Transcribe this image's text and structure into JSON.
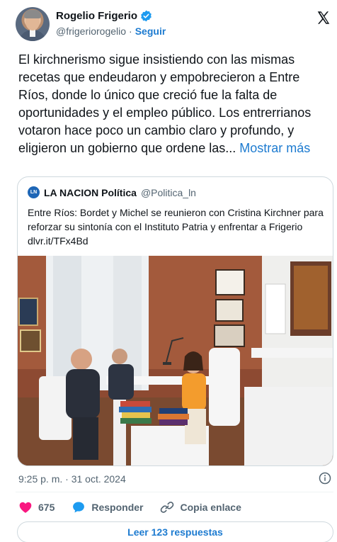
{
  "author": {
    "name": "Rogelio Frigerio",
    "handle": "@frigeriorogelio",
    "separator": "·",
    "follow_label": "Seguir",
    "verified": true
  },
  "tweet": {
    "text": "El kirchnerismo sigue insistiendo con las mismas recetas que endeudaron y empobrecieron a Entre Ríos, donde lo único que creció fue la falta de oportunidades y el empleo público. Los entrerrianos votaron hace poco un cambio claro y profundo, y eligieron un gobierno que ordene las...",
    "show_more": "Mostrar más"
  },
  "quoted": {
    "logo_text": "LN",
    "name": "LA NACION Política",
    "handle": "@Politica_ln",
    "text": "Entre Ríos: Bordet y Michel se reunieron con Cristina Kirchner para reforzar su sintonía con el Instituto Patria y enfrentar a Frigerio dlvr.it/TFx4Bd"
  },
  "meta": {
    "timestamp": "9:25 p. m. · 31 oct. 2024"
  },
  "actions": {
    "likes": "675",
    "reply_label": "Responder",
    "copy_label": "Copia enlace"
  },
  "read_replies": "Leer 123 respuestas",
  "colors": {
    "accent": "#1d7bd0",
    "like": "#f91880",
    "reply_bubble": "#1d9bf0",
    "text_secondary": "#536471",
    "border": "#cfd9de"
  },
  "icons": [
    "verified-badge-icon",
    "x-logo-icon",
    "info-icon",
    "heart-icon",
    "reply-bubble-icon",
    "link-icon"
  ]
}
